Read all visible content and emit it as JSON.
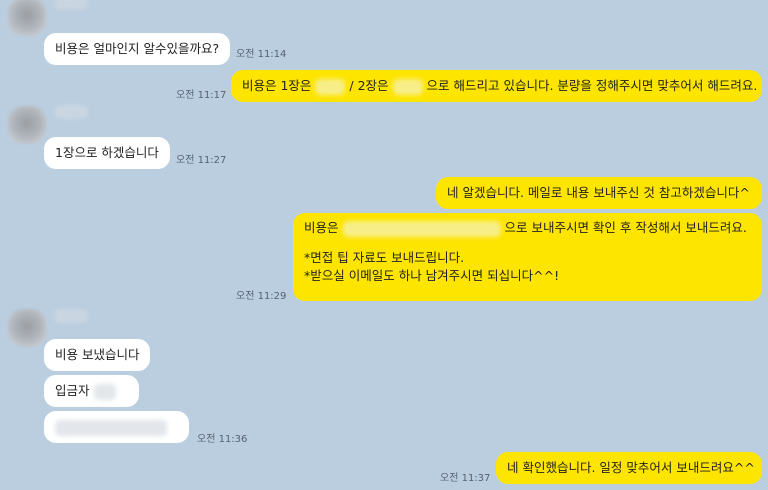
{
  "messages": {
    "m1": {
      "text": "비용은 얼마인지 알수있을까요?",
      "time": "오전 11:14"
    },
    "m2": {
      "part1": "비용은 1장은",
      "part2": "/ 2장은",
      "part3": "으로 해드리고 있습니다. 분량을 정해주시면 맞추어서 해드려요.",
      "time": "오전 11:17"
    },
    "m3": {
      "text": "1장으로 하겠습니다",
      "time": "오전 11:27"
    },
    "m4": {
      "text": "네 알겠습니다. 메일로 내용 보내주신 것 참고하겠습니다^"
    },
    "m5": {
      "part1": "비용은",
      "part2": "으로 보내주시면 확인 후 작성해서 보내드려요.",
      "line2": "*면접 팁 자료도 보내드립니다.",
      "line3": "*받으실 이메일도 하나 남겨주시면 되십니다^^!",
      "time": "오전 11:29"
    },
    "m6": {
      "text": "비용 보냈습니다"
    },
    "m7": {
      "text": "입금자"
    },
    "m8": {
      "time": "오전 11:36"
    },
    "m9": {
      "text": "네 확인했습니다. 일정 맞추어서 보내드려요^^",
      "time": "오전 11:37"
    }
  },
  "colors": {
    "background": "#bacee0",
    "outgoing": "#fee500",
    "incoming": "#ffffff"
  }
}
